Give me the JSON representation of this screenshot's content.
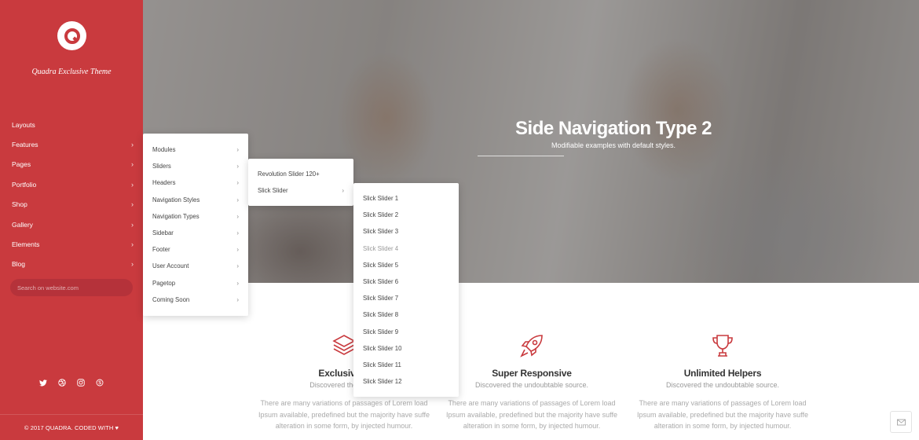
{
  "brand": {
    "tagline": "Quadra Exclusive Theme",
    "accent": "#c93a3e"
  },
  "sidebar": {
    "items": [
      {
        "label": "Layouts",
        "icon": ""
      },
      {
        "label": "Features",
        "icon": "›"
      },
      {
        "label": "Pages",
        "icon": "›"
      },
      {
        "label": "Portfolio",
        "icon": "›"
      },
      {
        "label": "Shop",
        "icon": "›"
      },
      {
        "label": "Gallery",
        "icon": "›"
      },
      {
        "label": "Elements",
        "icon": "›"
      },
      {
        "label": "Blog",
        "icon": "›"
      }
    ],
    "search_placeholder": "Search on website.com",
    "social": [
      "twitter-icon",
      "dribbble-icon",
      "instagram-icon",
      "skype-icon"
    ],
    "copyright": "© 2017 QUADRA. CODED WITH"
  },
  "hero": {
    "title": "Side Navigation Type 2",
    "subtitle": "Modifiable examples with default styles."
  },
  "menu1": {
    "items": [
      "Modules",
      "Sliders",
      "Headers",
      "Navigation Styles",
      "Navigation Types",
      "Sidebar",
      "Footer",
      "User Account",
      "Pagetop",
      "Coming Soon"
    ]
  },
  "menu2": {
    "items": [
      "Revolution Slider 120+",
      "Slick Slider"
    ]
  },
  "menu3": {
    "items": [
      "Slick Slider 1",
      "Slick Slider 2",
      "Slick Slider 3",
      "Slick Slider 4",
      "Slick Slider 5",
      "Slick Slider 6",
      "Slick Slider 7",
      "Slick Slider 8",
      "Slick Slider 9",
      "Slick Slider 10",
      "Slick Slider 11",
      "Slick Slider 12"
    ]
  },
  "features": [
    {
      "icon": "layers-icon",
      "title": "Exclusive D",
      "subtitle": "Discovered the undou",
      "body": "There are many variations of passages of Lorem load Ipsum available, predefined but the majority have suffe alteration in some form, by injected humour."
    },
    {
      "icon": "rocket-icon",
      "title": "Super Responsive",
      "subtitle": "Discovered the undoubtable source.",
      "body": "There are many variations of passages of Lorem load Ipsum available, predefined but the majority have suffe alteration in some form, by injected humour."
    },
    {
      "icon": "trophy-icon",
      "title": "Unlimited Helpers",
      "subtitle": "Discovered the undoubtable source.",
      "body": "There are many variations of passages of Lorem load Ipsum available, predefined but the majority have suffe alteration in some form, by injected humour."
    }
  ]
}
